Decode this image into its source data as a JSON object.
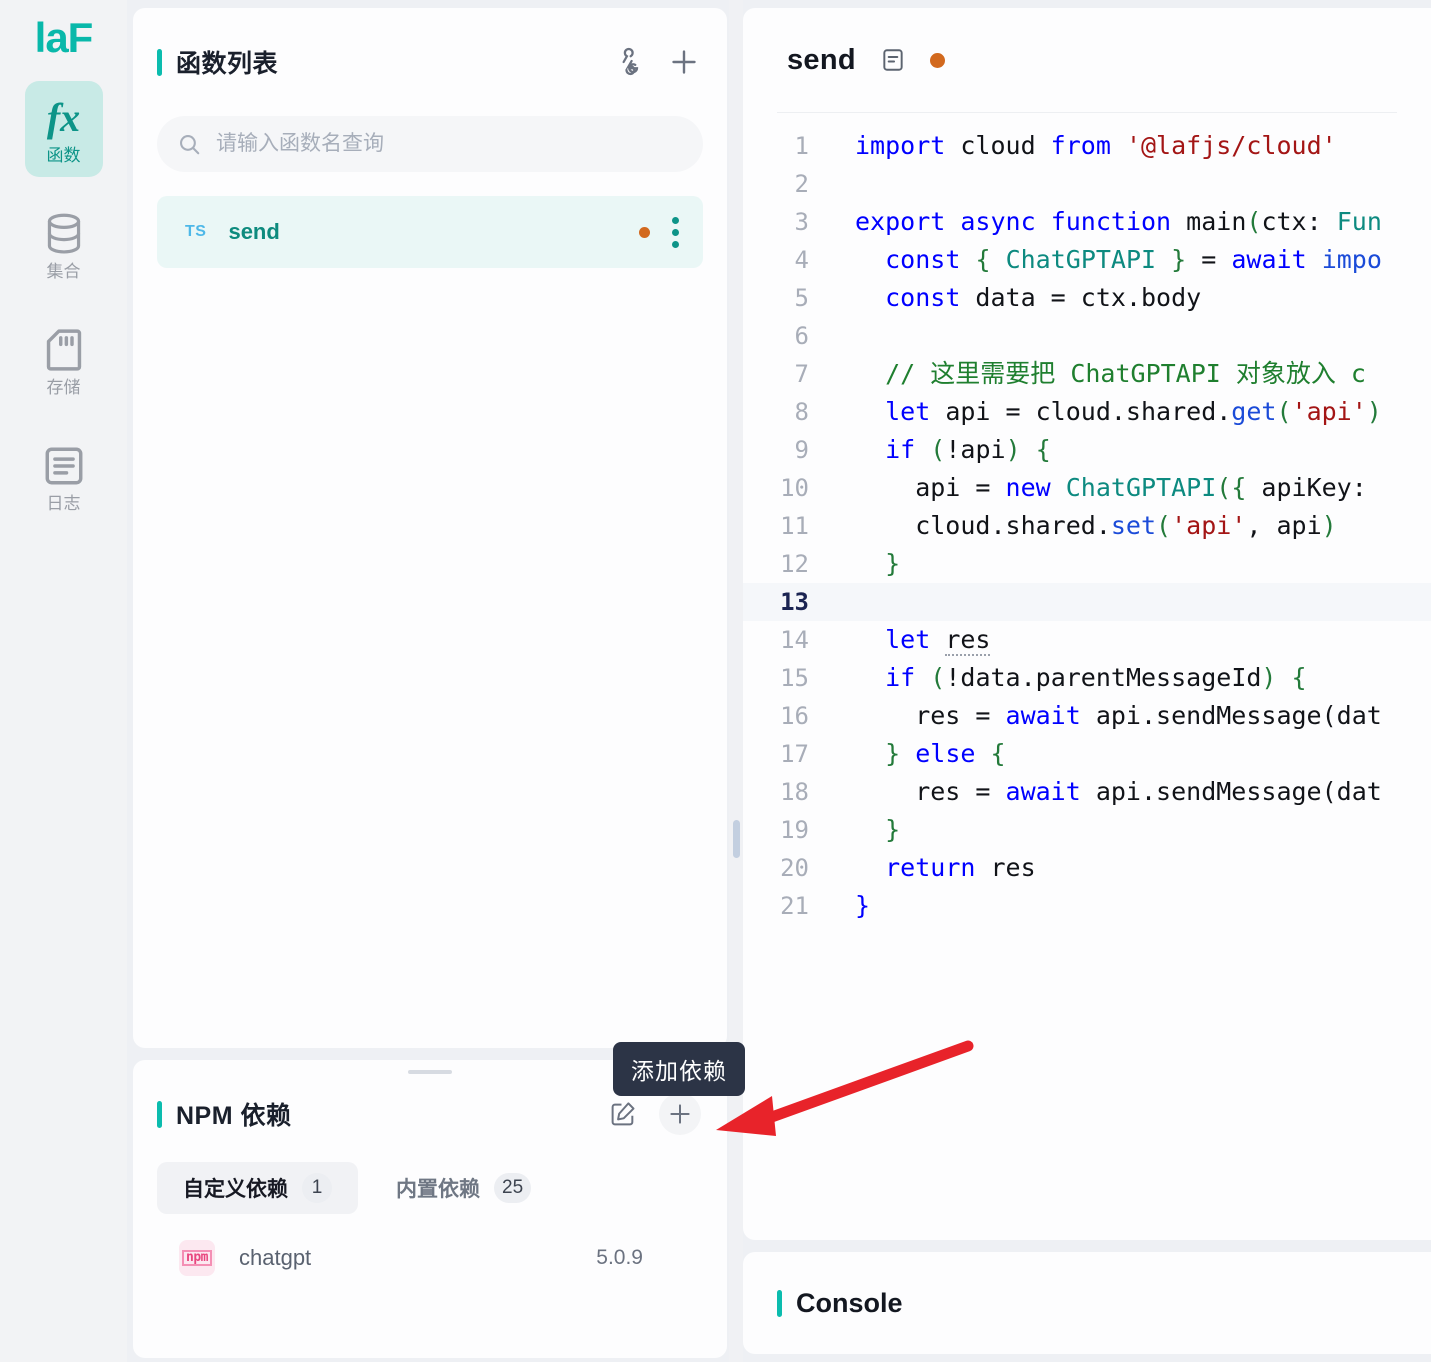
{
  "brand": {
    "logo": "laF",
    "logo_color": "#09b8aa"
  },
  "sidebar": {
    "items": [
      {
        "label": "函数",
        "icon": "function-fx-icon",
        "active": true
      },
      {
        "label": "集合",
        "icon": "database-icon",
        "active": false
      },
      {
        "label": "存储",
        "icon": "storage-card-icon",
        "active": false
      },
      {
        "label": "日志",
        "icon": "logs-document-icon",
        "active": false
      }
    ]
  },
  "function_panel": {
    "title": "函数列表",
    "actions": {
      "webhook_icon": "webhook-icon",
      "add_icon": "plus-icon"
    },
    "search": {
      "placeholder": "请输入函数名查询",
      "value": "",
      "icon": "search-icon"
    },
    "items": [
      {
        "lang_tag": "TS",
        "name": "send",
        "modified": true,
        "selected": true
      }
    ]
  },
  "npm_panel": {
    "title": "NPM 依赖",
    "actions": {
      "edit_icon": "edit-pencil-icon",
      "add_icon": "plus-icon"
    },
    "tabs": [
      {
        "label": "自定义依赖",
        "count": "1",
        "active": true
      },
      {
        "label": "内置依赖",
        "count": "25",
        "active": false
      }
    ],
    "dependencies": [
      {
        "registry": "npm",
        "name": "chatgpt",
        "version": "5.0.9"
      }
    ]
  },
  "editor": {
    "title": "send",
    "doc_icon": "description-icon",
    "status_dot_color": "#d2691e",
    "current_line": 13,
    "lines": [
      {
        "n": "1",
        "tokens": [
          {
            "t": "import",
            "c": "k"
          },
          {
            "t": " cloud ",
            "c": "pl"
          },
          {
            "t": "from",
            "c": "k"
          },
          {
            "t": " ",
            "c": "pl"
          },
          {
            "t": "'@lafjs/cloud'",
            "c": "st"
          }
        ]
      },
      {
        "n": "2",
        "tokens": []
      },
      {
        "n": "3",
        "tokens": [
          {
            "t": "export",
            "c": "k"
          },
          {
            "t": " ",
            "c": "pl"
          },
          {
            "t": "async",
            "c": "k"
          },
          {
            "t": " ",
            "c": "pl"
          },
          {
            "t": "function",
            "c": "k"
          },
          {
            "t": " main",
            "c": "pl"
          },
          {
            "t": "(",
            "c": "br"
          },
          {
            "t": "ctx: ",
            "c": "pl"
          },
          {
            "t": "Fun",
            "c": "ty"
          }
        ]
      },
      {
        "n": "4",
        "tokens": [
          {
            "t": "  ",
            "c": "pl"
          },
          {
            "t": "const",
            "c": "k"
          },
          {
            "t": " ",
            "c": "pl"
          },
          {
            "t": "{",
            "c": "br"
          },
          {
            "t": " ",
            "c": "pl"
          },
          {
            "t": "ChatGPTAPI",
            "c": "ty"
          },
          {
            "t": " ",
            "c": "pl"
          },
          {
            "t": "}",
            "c": "br"
          },
          {
            "t": " = ",
            "c": "pl"
          },
          {
            "t": "await",
            "c": "k"
          },
          {
            "t": " ",
            "c": "pl"
          },
          {
            "t": "impo",
            "c": "fn"
          }
        ]
      },
      {
        "n": "5",
        "tokens": [
          {
            "t": "  ",
            "c": "pl"
          },
          {
            "t": "const",
            "c": "k"
          },
          {
            "t": " data = ctx.body",
            "c": "pl"
          }
        ]
      },
      {
        "n": "6",
        "tokens": []
      },
      {
        "n": "7",
        "tokens": [
          {
            "t": "  ",
            "c": "pl"
          },
          {
            "t": "// 这里需要把 ChatGPTAPI 对象放入 c",
            "c": "cm"
          }
        ]
      },
      {
        "n": "8",
        "tokens": [
          {
            "t": "  ",
            "c": "pl"
          },
          {
            "t": "let",
            "c": "k"
          },
          {
            "t": " api = cloud.shared.",
            "c": "pl"
          },
          {
            "t": "get",
            "c": "fn"
          },
          {
            "t": "(",
            "c": "br"
          },
          {
            "t": "'api'",
            "c": "st"
          },
          {
            "t": ")",
            "c": "br"
          }
        ]
      },
      {
        "n": "9",
        "tokens": [
          {
            "t": "  ",
            "c": "pl"
          },
          {
            "t": "if",
            "c": "k"
          },
          {
            "t": " ",
            "c": "pl"
          },
          {
            "t": "(",
            "c": "br"
          },
          {
            "t": "!api",
            "c": "pl"
          },
          {
            "t": ")",
            "c": "br"
          },
          {
            "t": " ",
            "c": "pl"
          },
          {
            "t": "{",
            "c": "br"
          }
        ]
      },
      {
        "n": "10",
        "tokens": [
          {
            "t": "    api = ",
            "c": "pl"
          },
          {
            "t": "new",
            "c": "k"
          },
          {
            "t": " ",
            "c": "pl"
          },
          {
            "t": "ChatGPTAPI",
            "c": "ty"
          },
          {
            "t": "(",
            "c": "br"
          },
          {
            "t": "{",
            "c": "br"
          },
          {
            "t": " apiKey: ",
            "c": "pl"
          }
        ]
      },
      {
        "n": "11",
        "tokens": [
          {
            "t": "    cloud.shared.",
            "c": "pl"
          },
          {
            "t": "set",
            "c": "fn"
          },
          {
            "t": "(",
            "c": "br"
          },
          {
            "t": "'api'",
            "c": "st"
          },
          {
            "t": ", api",
            "c": "pl"
          },
          {
            "t": ")",
            "c": "br"
          }
        ]
      },
      {
        "n": "12",
        "tokens": [
          {
            "t": "  ",
            "c": "pl"
          },
          {
            "t": "}",
            "c": "br"
          }
        ]
      },
      {
        "n": "13",
        "tokens": []
      },
      {
        "n": "14",
        "tokens": [
          {
            "t": "  ",
            "c": "pl"
          },
          {
            "t": "let",
            "c": "k"
          },
          {
            "t": " ",
            "c": "pl"
          },
          {
            "t": "res",
            "c": "unused"
          }
        ]
      },
      {
        "n": "15",
        "tokens": [
          {
            "t": "  ",
            "c": "pl"
          },
          {
            "t": "if",
            "c": "k"
          },
          {
            "t": " ",
            "c": "pl"
          },
          {
            "t": "(",
            "c": "br"
          },
          {
            "t": "!data.parentMessageId",
            "c": "pl"
          },
          {
            "t": ")",
            "c": "br"
          },
          {
            "t": " ",
            "c": "pl"
          },
          {
            "t": "{",
            "c": "br"
          }
        ]
      },
      {
        "n": "16",
        "tokens": [
          {
            "t": "    res = ",
            "c": "pl"
          },
          {
            "t": "await",
            "c": "k"
          },
          {
            "t": " api.sendMessage(dat",
            "c": "pl"
          }
        ]
      },
      {
        "n": "17",
        "tokens": [
          {
            "t": "  ",
            "c": "pl"
          },
          {
            "t": "}",
            "c": "br"
          },
          {
            "t": " ",
            "c": "pl"
          },
          {
            "t": "else",
            "c": "k"
          },
          {
            "t": " ",
            "c": "pl"
          },
          {
            "t": "{",
            "c": "br"
          }
        ]
      },
      {
        "n": "18",
        "tokens": [
          {
            "t": "    res = ",
            "c": "pl"
          },
          {
            "t": "await",
            "c": "k"
          },
          {
            "t": " api.sendMessage(dat",
            "c": "pl"
          }
        ]
      },
      {
        "n": "19",
        "tokens": [
          {
            "t": "  ",
            "c": "pl"
          },
          {
            "t": "}",
            "c": "br"
          }
        ]
      },
      {
        "n": "20",
        "tokens": [
          {
            "t": "  ",
            "c": "pl"
          },
          {
            "t": "return",
            "c": "k"
          },
          {
            "t": " res",
            "c": "pl"
          }
        ]
      },
      {
        "n": "21",
        "tokens": [
          {
            "t": "}",
            "c": "k"
          }
        ]
      }
    ]
  },
  "console": {
    "title": "Console"
  },
  "annotation": {
    "tooltip": "添加依赖",
    "arrow_color": "#e8232a",
    "arrow_points_to": "npm-add-dependency-button"
  }
}
